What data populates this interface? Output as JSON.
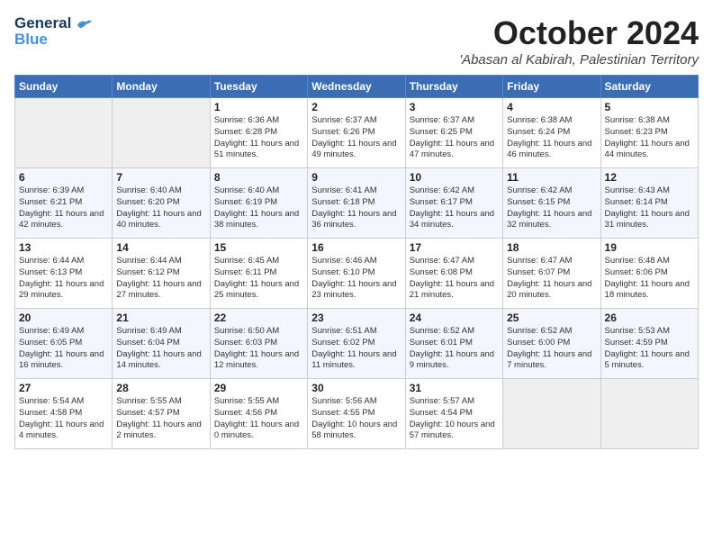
{
  "header": {
    "logo_line1": "General",
    "logo_line2": "Blue",
    "month": "October 2024",
    "location": "'Abasan al Kabirah, Palestinian Territory"
  },
  "weekdays": [
    "Sunday",
    "Monday",
    "Tuesday",
    "Wednesday",
    "Thursday",
    "Friday",
    "Saturday"
  ],
  "weeks": [
    [
      {
        "day": "",
        "sunrise": "",
        "sunset": "",
        "daylight": ""
      },
      {
        "day": "",
        "sunrise": "",
        "sunset": "",
        "daylight": ""
      },
      {
        "day": "1",
        "sunrise": "Sunrise: 6:36 AM",
        "sunset": "Sunset: 6:28 PM",
        "daylight": "Daylight: 11 hours and 51 minutes."
      },
      {
        "day": "2",
        "sunrise": "Sunrise: 6:37 AM",
        "sunset": "Sunset: 6:26 PM",
        "daylight": "Daylight: 11 hours and 49 minutes."
      },
      {
        "day": "3",
        "sunrise": "Sunrise: 6:37 AM",
        "sunset": "Sunset: 6:25 PM",
        "daylight": "Daylight: 11 hours and 47 minutes."
      },
      {
        "day": "4",
        "sunrise": "Sunrise: 6:38 AM",
        "sunset": "Sunset: 6:24 PM",
        "daylight": "Daylight: 11 hours and 46 minutes."
      },
      {
        "day": "5",
        "sunrise": "Sunrise: 6:38 AM",
        "sunset": "Sunset: 6:23 PM",
        "daylight": "Daylight: 11 hours and 44 minutes."
      }
    ],
    [
      {
        "day": "6",
        "sunrise": "Sunrise: 6:39 AM",
        "sunset": "Sunset: 6:21 PM",
        "daylight": "Daylight: 11 hours and 42 minutes."
      },
      {
        "day": "7",
        "sunrise": "Sunrise: 6:40 AM",
        "sunset": "Sunset: 6:20 PM",
        "daylight": "Daylight: 11 hours and 40 minutes."
      },
      {
        "day": "8",
        "sunrise": "Sunrise: 6:40 AM",
        "sunset": "Sunset: 6:19 PM",
        "daylight": "Daylight: 11 hours and 38 minutes."
      },
      {
        "day": "9",
        "sunrise": "Sunrise: 6:41 AM",
        "sunset": "Sunset: 6:18 PM",
        "daylight": "Daylight: 11 hours and 36 minutes."
      },
      {
        "day": "10",
        "sunrise": "Sunrise: 6:42 AM",
        "sunset": "Sunset: 6:17 PM",
        "daylight": "Daylight: 11 hours and 34 minutes."
      },
      {
        "day": "11",
        "sunrise": "Sunrise: 6:42 AM",
        "sunset": "Sunset: 6:15 PM",
        "daylight": "Daylight: 11 hours and 32 minutes."
      },
      {
        "day": "12",
        "sunrise": "Sunrise: 6:43 AM",
        "sunset": "Sunset: 6:14 PM",
        "daylight": "Daylight: 11 hours and 31 minutes."
      }
    ],
    [
      {
        "day": "13",
        "sunrise": "Sunrise: 6:44 AM",
        "sunset": "Sunset: 6:13 PM",
        "daylight": "Daylight: 11 hours and 29 minutes."
      },
      {
        "day": "14",
        "sunrise": "Sunrise: 6:44 AM",
        "sunset": "Sunset: 6:12 PM",
        "daylight": "Daylight: 11 hours and 27 minutes."
      },
      {
        "day": "15",
        "sunrise": "Sunrise: 6:45 AM",
        "sunset": "Sunset: 6:11 PM",
        "daylight": "Daylight: 11 hours and 25 minutes."
      },
      {
        "day": "16",
        "sunrise": "Sunrise: 6:46 AM",
        "sunset": "Sunset: 6:10 PM",
        "daylight": "Daylight: 11 hours and 23 minutes."
      },
      {
        "day": "17",
        "sunrise": "Sunrise: 6:47 AM",
        "sunset": "Sunset: 6:08 PM",
        "daylight": "Daylight: 11 hours and 21 minutes."
      },
      {
        "day": "18",
        "sunrise": "Sunrise: 6:47 AM",
        "sunset": "Sunset: 6:07 PM",
        "daylight": "Daylight: 11 hours and 20 minutes."
      },
      {
        "day": "19",
        "sunrise": "Sunrise: 6:48 AM",
        "sunset": "Sunset: 6:06 PM",
        "daylight": "Daylight: 11 hours and 18 minutes."
      }
    ],
    [
      {
        "day": "20",
        "sunrise": "Sunrise: 6:49 AM",
        "sunset": "Sunset: 6:05 PM",
        "daylight": "Daylight: 11 hours and 16 minutes."
      },
      {
        "day": "21",
        "sunrise": "Sunrise: 6:49 AM",
        "sunset": "Sunset: 6:04 PM",
        "daylight": "Daylight: 11 hours and 14 minutes."
      },
      {
        "day": "22",
        "sunrise": "Sunrise: 6:50 AM",
        "sunset": "Sunset: 6:03 PM",
        "daylight": "Daylight: 11 hours and 12 minutes."
      },
      {
        "day": "23",
        "sunrise": "Sunrise: 6:51 AM",
        "sunset": "Sunset: 6:02 PM",
        "daylight": "Daylight: 11 hours and 11 minutes."
      },
      {
        "day": "24",
        "sunrise": "Sunrise: 6:52 AM",
        "sunset": "Sunset: 6:01 PM",
        "daylight": "Daylight: 11 hours and 9 minutes."
      },
      {
        "day": "25",
        "sunrise": "Sunrise: 6:52 AM",
        "sunset": "Sunset: 6:00 PM",
        "daylight": "Daylight: 11 hours and 7 minutes."
      },
      {
        "day": "26",
        "sunrise": "Sunrise: 5:53 AM",
        "sunset": "Sunset: 4:59 PM",
        "daylight": "Daylight: 11 hours and 5 minutes."
      }
    ],
    [
      {
        "day": "27",
        "sunrise": "Sunrise: 5:54 AM",
        "sunset": "Sunset: 4:58 PM",
        "daylight": "Daylight: 11 hours and 4 minutes."
      },
      {
        "day": "28",
        "sunrise": "Sunrise: 5:55 AM",
        "sunset": "Sunset: 4:57 PM",
        "daylight": "Daylight: 11 hours and 2 minutes."
      },
      {
        "day": "29",
        "sunrise": "Sunrise: 5:55 AM",
        "sunset": "Sunset: 4:56 PM",
        "daylight": "Daylight: 11 hours and 0 minutes."
      },
      {
        "day": "30",
        "sunrise": "Sunrise: 5:56 AM",
        "sunset": "Sunset: 4:55 PM",
        "daylight": "Daylight: 10 hours and 58 minutes."
      },
      {
        "day": "31",
        "sunrise": "Sunrise: 5:57 AM",
        "sunset": "Sunset: 4:54 PM",
        "daylight": "Daylight: 10 hours and 57 minutes."
      },
      {
        "day": "",
        "sunrise": "",
        "sunset": "",
        "daylight": ""
      },
      {
        "day": "",
        "sunrise": "",
        "sunset": "",
        "daylight": ""
      }
    ]
  ]
}
